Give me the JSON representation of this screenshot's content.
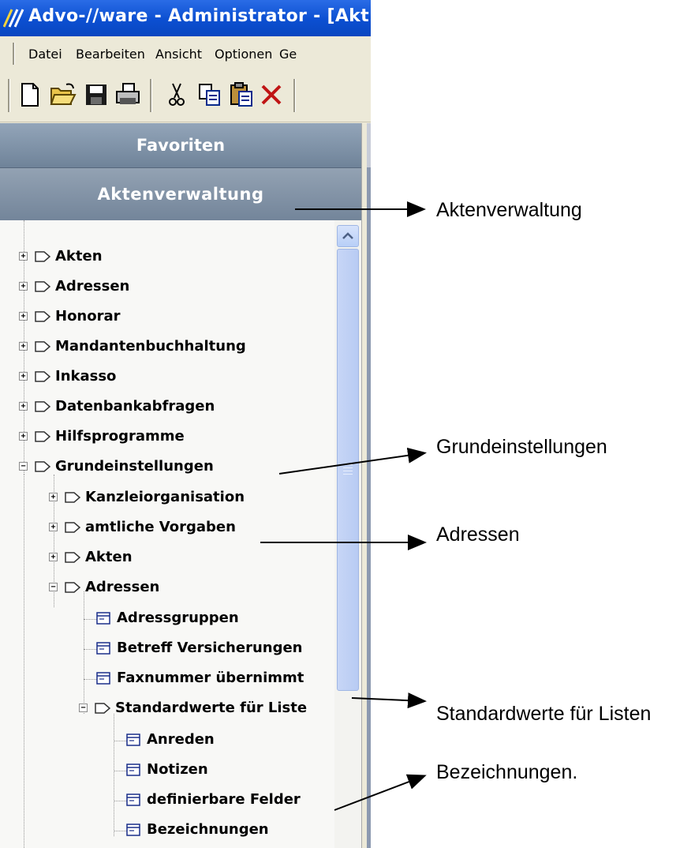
{
  "window": {
    "title": "Advo-//ware  -  Administrator - [Akt"
  },
  "menu": [
    "Datei",
    "Bearbeiten",
    "Ansicht",
    "Optionen",
    "Ge"
  ],
  "toolbar": {
    "icons": [
      "new-document-icon",
      "open-folder-icon",
      "save-icon",
      "print-icon",
      "cut-icon",
      "copy-icon",
      "paste-icon",
      "delete-icon"
    ]
  },
  "sidebar": {
    "favoriten": "Favoriten",
    "aktenverwaltung": "Aktenverwaltung",
    "tree": [
      {
        "label": "Akten",
        "expander": "+"
      },
      {
        "label": "Adressen",
        "expander": "+"
      },
      {
        "label": "Honorar",
        "expander": "+"
      },
      {
        "label": "Mandantenbuchhaltung",
        "expander": "+"
      },
      {
        "label": "Inkasso",
        "expander": "+"
      },
      {
        "label": "Datenbankabfragen",
        "expander": "+"
      },
      {
        "label": "Hilfsprogramme",
        "expander": "+"
      },
      {
        "label": "Grundeinstellungen",
        "expander": "−"
      },
      {
        "label": "Kanzleiorganisation",
        "expander": "+"
      },
      {
        "label": "amtliche Vorgaben",
        "expander": "+"
      },
      {
        "label": "Akten",
        "expander": "+"
      },
      {
        "label": "Adressen",
        "expander": "−"
      },
      {
        "label": "Adressgruppen"
      },
      {
        "label": "Betreff Versicherungen"
      },
      {
        "label": "Faxnummer übernimmt"
      },
      {
        "label": "Standardwerte für Liste",
        "expander": "−"
      },
      {
        "label": "Anreden"
      },
      {
        "label": "Notizen"
      },
      {
        "label": "definierbare Felder"
      },
      {
        "label": "Bezeichnungen"
      }
    ]
  },
  "annotations": {
    "aktenverwaltung": "Aktenverwaltung",
    "grundeinstellungen": "Grundeinstellungen",
    "adressen": "Adressen",
    "standardwerte": "Standardwerte für Listen",
    "bezeichnungen": "Bezeichnungen."
  },
  "colors": {
    "titlebar": "#0b4fd1",
    "sidebar_header": "#7f91a6",
    "scrollbar": "#b8cbf3"
  }
}
